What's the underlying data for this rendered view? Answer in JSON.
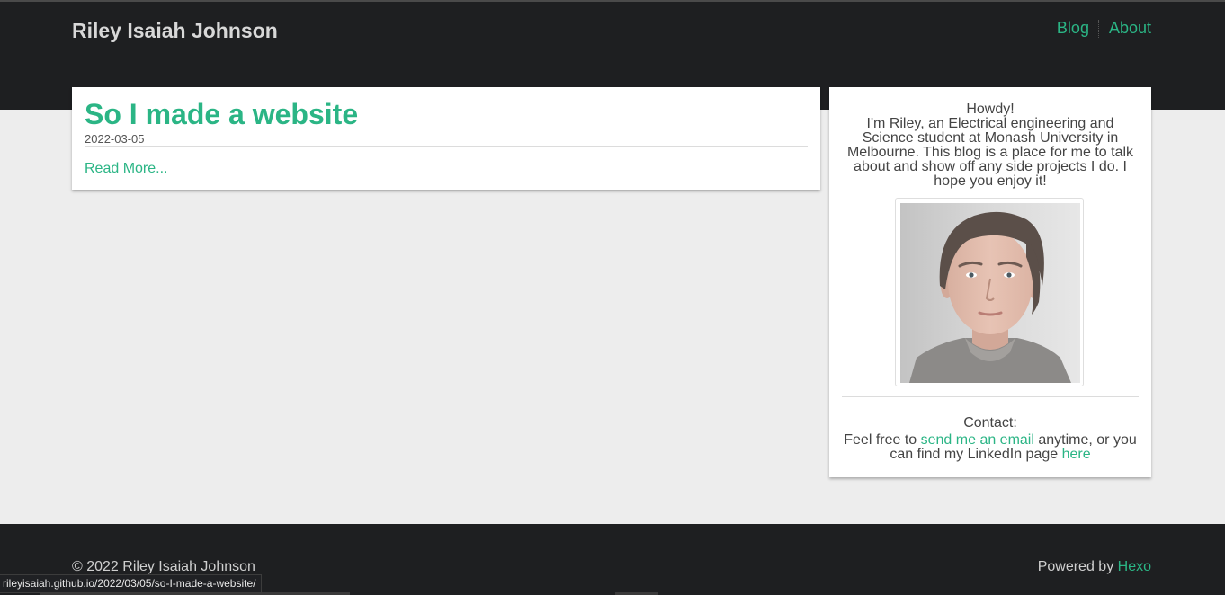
{
  "site": {
    "title": "Riley Isaiah Johnson"
  },
  "nav": {
    "items": [
      {
        "label": "Blog"
      },
      {
        "label": "About"
      }
    ]
  },
  "post": {
    "title": "So I made a website",
    "date": "2022-03-05",
    "read_more": "Read More..."
  },
  "sidebar": {
    "greeting": "Howdy!",
    "bio": "I'm Riley, an Electrical engineering and Science student at Monash University in Melbourne. This blog is a place for me to talk about and show off any side projects I do. I hope you enjoy it!",
    "contact_label": "Contact:",
    "contact_prefix": "Feel free to ",
    "email_link": "send me an email",
    "contact_middle": " anytime, or you can find my LinkedIn page ",
    "linkedin_link": "here"
  },
  "footer": {
    "copyright": "© 2022 Riley Isaiah Johnson",
    "powered_prefix": "Powered by ",
    "powered_link": "Hexo"
  },
  "status_bar": {
    "url": "rileyisaiah.github.io/2022/03/05/so-I-made-a-website/"
  },
  "colors": {
    "accent": "#2bb585",
    "header_bg": "#1e1f21",
    "page_bg": "#ededed"
  }
}
